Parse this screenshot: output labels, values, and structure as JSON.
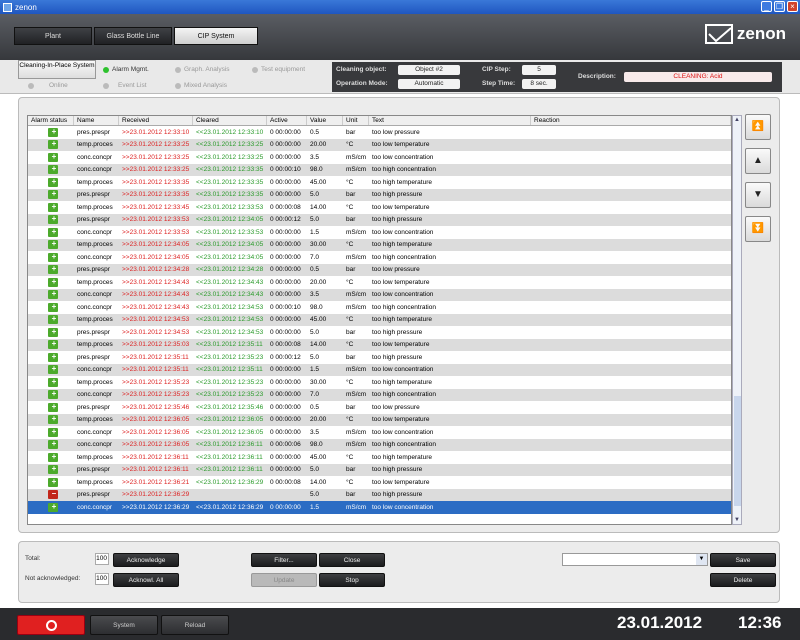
{
  "window": {
    "title": "zenon"
  },
  "nav": {
    "tabs": [
      "Plant",
      "Glass Bottle Line",
      "CIP System"
    ],
    "active": "CIP System"
  },
  "logo": {
    "text": "zenon"
  },
  "subnav": {
    "cleaning": "Cleaning-In-Place System",
    "alarm": "Alarm Mgmt.",
    "graph": "Graph. Analysis",
    "test": "Test equipment",
    "online": "Online",
    "event": "Event List",
    "mixed": "Mixed Analysis"
  },
  "info": {
    "cleaning_object_label": "Cleaning object:",
    "cleaning_object": "Object #2",
    "operation_mode_label": "Operation Mode:",
    "operation_mode": "Automatic",
    "cip_step_label": "CIP Step:",
    "cip_step": "5",
    "step_time_label": "Step Time:",
    "step_time": "8 sec.",
    "description_label": "Description:",
    "description": "CLEANING: Acid"
  },
  "table": {
    "headers": [
      "Alarm status",
      "Name",
      "Received",
      "Cleared",
      "Active",
      "Value",
      "Unit",
      "Text",
      "Reaction"
    ],
    "rows": [
      [
        "pres.prespr",
        ">>23.01.2012 12:33:10",
        "<<23.01.2012 12:33:10",
        "0 00:00:00",
        "0.5",
        "bar",
        "too low pressure",
        "g"
      ],
      [
        "temp.proces",
        ">>23.01.2012 12:33:25",
        "<<23.01.2012 12:33:25",
        "0 00:00:00",
        "20.00",
        "°C",
        "too low temperature",
        "g"
      ],
      [
        "conc.concpr",
        ">>23.01.2012 12:33:25",
        "<<23.01.2012 12:33:25",
        "0 00:00:00",
        "3.5",
        "mS/cm",
        "too low concentration",
        "g"
      ],
      [
        "conc.concpr",
        ">>23.01.2012 12:33:25",
        "<<23.01.2012 12:33:35",
        "0 00:00:10",
        "98.0",
        "mS/cm",
        "too high concentration",
        "g"
      ],
      [
        "temp.proces",
        ">>23.01.2012 12:33:35",
        "<<23.01.2012 12:33:35",
        "0 00:00:00",
        "45.00",
        "°C",
        "too high temperature",
        "g"
      ],
      [
        "pres.prespr",
        ">>23.01.2012 12:33:35",
        "<<23.01.2012 12:33:35",
        "0 00:00:00",
        "5.0",
        "bar",
        "too high pressure",
        "g"
      ],
      [
        "temp.proces",
        ">>23.01.2012 12:33:45",
        "<<23.01.2012 12:33:53",
        "0 00:00:08",
        "14.00",
        "°C",
        "too low temperature",
        "g"
      ],
      [
        "pres.prespr",
        ">>23.01.2012 12:33:53",
        "<<23.01.2012 12:34:05",
        "0 00:00:12",
        "5.0",
        "bar",
        "too high pressure",
        "g"
      ],
      [
        "conc.concpr",
        ">>23.01.2012 12:33:53",
        "<<23.01.2012 12:33:53",
        "0 00:00:00",
        "1.5",
        "mS/cm",
        "too low concentration",
        "g"
      ],
      [
        "temp.proces",
        ">>23.01.2012 12:34:05",
        "<<23.01.2012 12:34:05",
        "0 00:00:00",
        "30.00",
        "°C",
        "too high temperature",
        "g"
      ],
      [
        "conc.concpr",
        ">>23.01.2012 12:34:05",
        "<<23.01.2012 12:34:05",
        "0 00:00:00",
        "7.0",
        "mS/cm",
        "too high concentration",
        "g"
      ],
      [
        "pres.prespr",
        ">>23.01.2012 12:34:28",
        "<<23.01.2012 12:34:28",
        "0 00:00:00",
        "0.5",
        "bar",
        "too low pressure",
        "g"
      ],
      [
        "temp.proces",
        ">>23.01.2012 12:34:43",
        "<<23.01.2012 12:34:43",
        "0 00:00:00",
        "20.00",
        "°C",
        "too low temperature",
        "g"
      ],
      [
        "conc.concpr",
        ">>23.01.2012 12:34:43",
        "<<23.01.2012 12:34:43",
        "0 00:00:00",
        "3.5",
        "mS/cm",
        "too low concentration",
        "g"
      ],
      [
        "conc.concpr",
        ">>23.01.2012 12:34:43",
        "<<23.01.2012 12:34:53",
        "0 00:00:10",
        "98.0",
        "mS/cm",
        "too high concentration",
        "g"
      ],
      [
        "temp.proces",
        ">>23.01.2012 12:34:53",
        "<<23.01.2012 12:34:53",
        "0 00:00:00",
        "45.00",
        "°C",
        "too high temperature",
        "g"
      ],
      [
        "pres.prespr",
        ">>23.01.2012 12:34:53",
        "<<23.01.2012 12:34:53",
        "0 00:00:00",
        "5.0",
        "bar",
        "too high pressure",
        "g"
      ],
      [
        "temp.proces",
        ">>23.01.2012 12:35:03",
        "<<23.01.2012 12:35:11",
        "0 00:00:08",
        "14.00",
        "°C",
        "too low temperature",
        "g"
      ],
      [
        "pres.prespr",
        ">>23.01.2012 12:35:11",
        "<<23.01.2012 12:35:23",
        "0 00:00:12",
        "5.0",
        "bar",
        "too high pressure",
        "g"
      ],
      [
        "conc.concpr",
        ">>23.01.2012 12:35:11",
        "<<23.01.2012 12:35:11",
        "0 00:00:00",
        "1.5",
        "mS/cm",
        "too low concentration",
        "g"
      ],
      [
        "temp.proces",
        ">>23.01.2012 12:35:23",
        "<<23.01.2012 12:35:23",
        "0 00:00:00",
        "30.00",
        "°C",
        "too high temperature",
        "g"
      ],
      [
        "conc.concpr",
        ">>23.01.2012 12:35:23",
        "<<23.01.2012 12:35:23",
        "0 00:00:00",
        "7.0",
        "mS/cm",
        "too high concentration",
        "g"
      ],
      [
        "pres.prespr",
        ">>23.01.2012 12:35:46",
        "<<23.01.2012 12:35:46",
        "0 00:00:00",
        "0.5",
        "bar",
        "too low pressure",
        "g"
      ],
      [
        "temp.proces",
        ">>23.01.2012 12:36:05",
        "<<23.01.2012 12:36:05",
        "0 00:00:00",
        "20.00",
        "°C",
        "too low temperature",
        "g"
      ],
      [
        "conc.concpr",
        ">>23.01.2012 12:36:05",
        "<<23.01.2012 12:36:05",
        "0 00:00:00",
        "3.5",
        "mS/cm",
        "too low concentration",
        "g"
      ],
      [
        "conc.concpr",
        ">>23.01.2012 12:36:05",
        "<<23.01.2012 12:36:11",
        "0 00:00:06",
        "98.0",
        "mS/cm",
        "too high concentration",
        "g"
      ],
      [
        "temp.proces",
        ">>23.01.2012 12:36:11",
        "<<23.01.2012 12:36:11",
        "0 00:00:00",
        "45.00",
        "°C",
        "too high temperature",
        "g"
      ],
      [
        "pres.prespr",
        ">>23.01.2012 12:36:11",
        "<<23.01.2012 12:36:11",
        "0 00:00:00",
        "5.0",
        "bar",
        "too high pressure",
        "g"
      ],
      [
        "temp.proces",
        ">>23.01.2012 12:36:21",
        "<<23.01.2012 12:36:29",
        "0 00:00:08",
        "14.00",
        "°C",
        "too low temperature",
        "g"
      ],
      [
        "pres.prespr",
        ">>23.01.2012 12:36:29",
        "",
        "",
        "5.0",
        "bar",
        "too high pressure",
        "r"
      ],
      [
        "conc.concpr",
        ">>23.01.2012 12:36:29",
        "<<23.01.2012 12:36:29",
        "0 00:00:00",
        "1.5",
        "mS/cm",
        "too low concentration",
        "s"
      ]
    ]
  },
  "footer": {
    "total_label": "Total:",
    "total": "100",
    "not_ack_label": "Not acknowledged:",
    "not_ack": "100",
    "acknowledge": "Acknowledge",
    "acknowl_all": "Acknowl. All",
    "filter": "Filter...",
    "update": "Update",
    "close": "Close",
    "stop": "Stop",
    "save": "Save",
    "delete": "Delete"
  },
  "bottom": {
    "system": "System",
    "reload": "Reload",
    "date": "23.01.2012",
    "time": "12:36"
  },
  "colors": {
    "received": "#dd2222",
    "cleared": "#2a9a2a",
    "selected": "#2b6cc4",
    "ack_green": "#4caa2c",
    "ack_red": "#c2261b"
  }
}
